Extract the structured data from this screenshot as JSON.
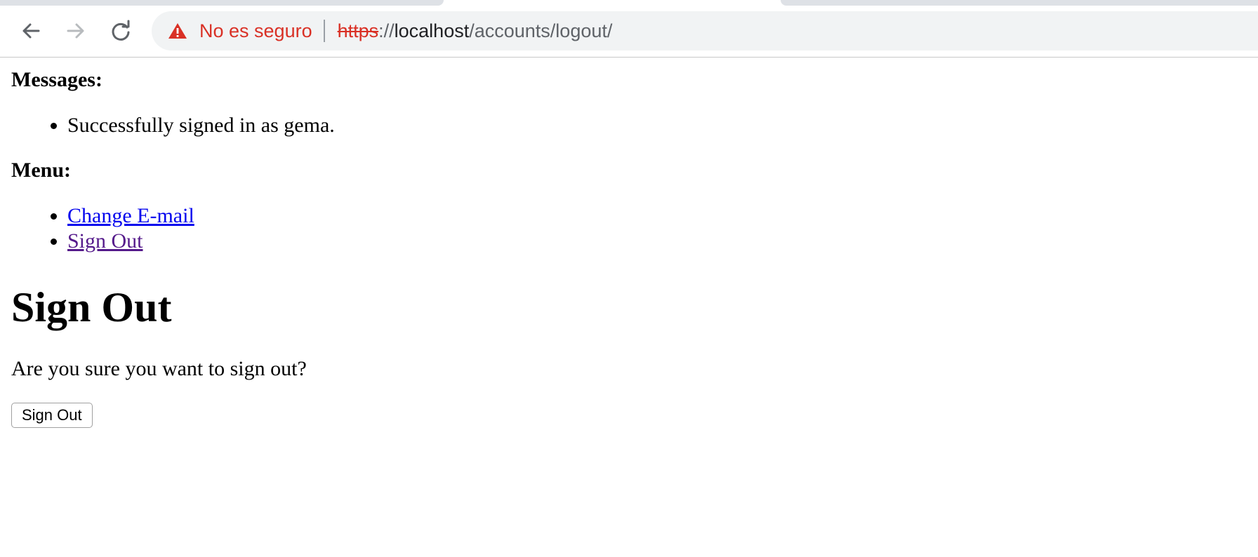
{
  "browser": {
    "security_label": "No es seguro",
    "url": {
      "scheme": "https",
      "separator": "://",
      "host": "localhost",
      "path": "/accounts/logout/"
    }
  },
  "messages": {
    "heading": "Messages:",
    "items": [
      "Successfully signed in as gema."
    ]
  },
  "menu": {
    "heading": "Menu:",
    "items": [
      {
        "label": "Change E-mail",
        "visited": false
      },
      {
        "label": "Sign Out",
        "visited": true
      }
    ]
  },
  "content": {
    "title": "Sign Out",
    "prompt": "Are you sure you want to sign out?",
    "button_label": "Sign Out"
  },
  "colors": {
    "warning": "#d93025",
    "link": "#0000ee",
    "visited_link": "#551a8b"
  },
  "icons": {
    "back": "arrow-left-icon",
    "forward": "arrow-right-icon",
    "reload": "reload-icon",
    "warning": "warning-triangle-icon"
  }
}
